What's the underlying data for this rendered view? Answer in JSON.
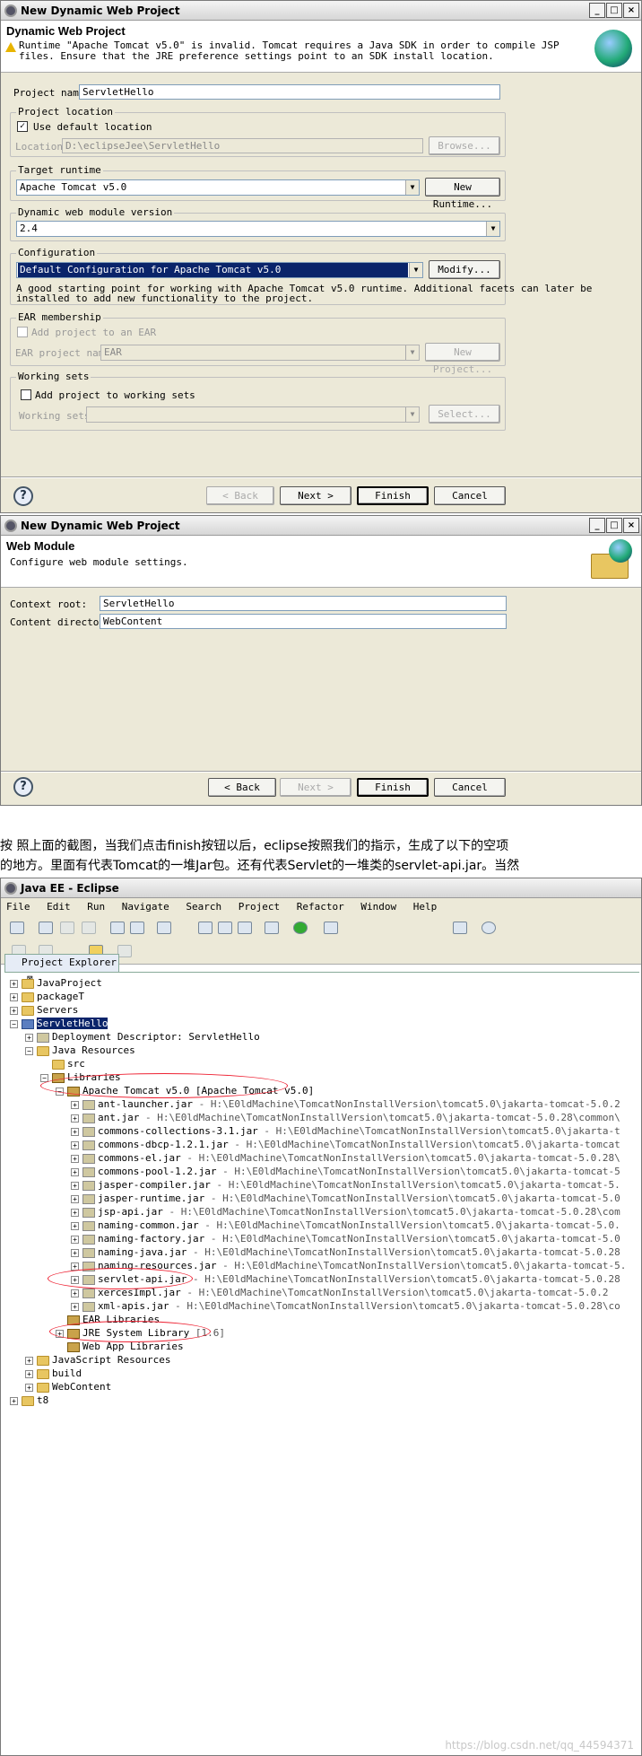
{
  "dialog1": {
    "title": "New Dynamic Web Project",
    "heading": "Dynamic Web Project",
    "warning_line1": "Runtime \"Apache Tomcat v5.0\" is invalid. Tomcat requires a Java SDK in order to compile JSP",
    "warning_line2": "files. Ensure that the JRE preference settings point to an SDK install location.",
    "project_name_label": "Project name:",
    "project_name_value": "ServletHello",
    "location_group": "Project location",
    "use_default_label": "Use default location",
    "location_label": "Location:",
    "location_value": "D:\\eclipseJee\\ServletHello",
    "browse_label": "Browse...",
    "target_runtime_group": "Target runtime",
    "target_runtime_value": "Apache Tomcat v5.0",
    "new_runtime_label": "New Runtime...",
    "module_version_group": "Dynamic web module version",
    "module_version_value": "2.4",
    "configuration_group": "Configuration",
    "configuration_value": "Default Configuration for Apache Tomcat v5.0",
    "modify_label": "Modify...",
    "configuration_desc1": "A good starting point for working with Apache Tomcat v5.0 runtime. Additional facets can later be",
    "configuration_desc2": "installed to add new functionality to the project.",
    "ear_group": "EAR membership",
    "add_to_ear_label": "Add project to an EAR",
    "ear_name_label": "EAR project name:",
    "ear_name_value": "EAR",
    "new_project_label": "New Project...",
    "working_sets_group": "Working sets",
    "add_working_sets_label": "Add project to working sets",
    "working_sets_label": "Working sets:",
    "select_label": "Select...",
    "back_label": "< Back",
    "next_label": "Next >",
    "finish_label": "Finish",
    "cancel_label": "Cancel"
  },
  "dialog2": {
    "title": "New Dynamic Web Project",
    "heading": "Web Module",
    "subheading": "Configure web module settings.",
    "context_root_label": "Context root:",
    "context_root_value": "ServletHello",
    "content_dir_label": "Content directory:",
    "content_dir_value": "WebContent",
    "back_label": "< Back",
    "next_label": "Next >",
    "finish_label": "Finish",
    "cancel_label": "Cancel"
  },
  "note": {
    "line1": "按 照上面的截图，当我们点击finish按钮以后，eclipse按照我们的指示，生成了以下的空项",
    "line2": "的地方。里面有代表Tomcat的一堆Jar包。还有代表Servlet的一堆类的servlet-api.jar。当然"
  },
  "eclipse": {
    "title": "Java EE - Eclipse",
    "menu": [
      "File",
      "Edit",
      "Run",
      "Navigate",
      "Search",
      "Project",
      "Refactor",
      "Window",
      "Help"
    ],
    "view_tab": "Project Explorer",
    "tree": [
      {
        "indent": 0,
        "pm": "+",
        "icon": "folder",
        "label": "JavaProject",
        "path": ""
      },
      {
        "indent": 0,
        "pm": "+",
        "icon": "folder",
        "label": "packageT",
        "path": ""
      },
      {
        "indent": 0,
        "pm": "+",
        "icon": "folder",
        "label": "Servers",
        "path": ""
      },
      {
        "indent": 0,
        "pm": "-",
        "icon": "proj",
        "label": "ServletHello",
        "path": "",
        "selected": true
      },
      {
        "indent": 1,
        "pm": "+",
        "icon": "jar",
        "label": "Deployment Descriptor: ServletHello",
        "path": ""
      },
      {
        "indent": 1,
        "pm": "-",
        "icon": "folder",
        "label": "Java Resources",
        "path": ""
      },
      {
        "indent": 2,
        "pm": "",
        "icon": "folder",
        "label": "src",
        "path": ""
      },
      {
        "indent": 2,
        "pm": "-",
        "icon": "lib",
        "label": "Libraries",
        "path": ""
      },
      {
        "indent": 3,
        "pm": "-",
        "icon": "lib",
        "label": "Apache Tomcat v5.0 [Apache Tomcat v5.0]",
        "path": ""
      },
      {
        "indent": 4,
        "pm": "+",
        "icon": "jar",
        "label": "ant-launcher.jar",
        "path": " - H:\\E0ldMachine\\TomcatNonInstallVersion\\tomcat5.0\\jakarta-tomcat-5.0.2"
      },
      {
        "indent": 4,
        "pm": "+",
        "icon": "jar",
        "label": "ant.jar",
        "path": " - H:\\E0ldMachine\\TomcatNonInstallVersion\\tomcat5.0\\jakarta-tomcat-5.0.28\\common\\"
      },
      {
        "indent": 4,
        "pm": "+",
        "icon": "jar",
        "label": "commons-collections-3.1.jar",
        "path": " - H:\\E0ldMachine\\TomcatNonInstallVersion\\tomcat5.0\\jakarta-t"
      },
      {
        "indent": 4,
        "pm": "+",
        "icon": "jar",
        "label": "commons-dbcp-1.2.1.jar",
        "path": " - H:\\E0ldMachine\\TomcatNonInstallVersion\\tomcat5.0\\jakarta-tomcat"
      },
      {
        "indent": 4,
        "pm": "+",
        "icon": "jar",
        "label": "commons-el.jar",
        "path": " - H:\\E0ldMachine\\TomcatNonInstallVersion\\tomcat5.0\\jakarta-tomcat-5.0.28\\"
      },
      {
        "indent": 4,
        "pm": "+",
        "icon": "jar",
        "label": "commons-pool-1.2.jar",
        "path": " - H:\\E0ldMachine\\TomcatNonInstallVersion\\tomcat5.0\\jakarta-tomcat-5"
      },
      {
        "indent": 4,
        "pm": "+",
        "icon": "jar",
        "label": "jasper-compiler.jar",
        "path": " - H:\\E0ldMachine\\TomcatNonInstallVersion\\tomcat5.0\\jakarta-tomcat-5."
      },
      {
        "indent": 4,
        "pm": "+",
        "icon": "jar",
        "label": "jasper-runtime.jar",
        "path": " - H:\\E0ldMachine\\TomcatNonInstallVersion\\tomcat5.0\\jakarta-tomcat-5.0"
      },
      {
        "indent": 4,
        "pm": "+",
        "icon": "jar",
        "label": "jsp-api.jar",
        "path": " - H:\\E0ldMachine\\TomcatNonInstallVersion\\tomcat5.0\\jakarta-tomcat-5.0.28\\com"
      },
      {
        "indent": 4,
        "pm": "+",
        "icon": "jar",
        "label": "naming-common.jar",
        "path": " - H:\\E0ldMachine\\TomcatNonInstallVersion\\tomcat5.0\\jakarta-tomcat-5.0."
      },
      {
        "indent": 4,
        "pm": "+",
        "icon": "jar",
        "label": "naming-factory.jar",
        "path": " - H:\\E0ldMachine\\TomcatNonInstallVersion\\tomcat5.0\\jakarta-tomcat-5.0"
      },
      {
        "indent": 4,
        "pm": "+",
        "icon": "jar",
        "label": "naming-java.jar",
        "path": " - H:\\E0ldMachine\\TomcatNonInstallVersion\\tomcat5.0\\jakarta-tomcat-5.0.28"
      },
      {
        "indent": 4,
        "pm": "+",
        "icon": "jar",
        "label": "naming-resources.jar",
        "path": " - H:\\E0ldMachine\\TomcatNonInstallVersion\\tomcat5.0\\jakarta-tomcat-5."
      },
      {
        "indent": 4,
        "pm": "+",
        "icon": "jar",
        "label": "servlet-api.jar",
        "path": " - H:\\E0ldMachine\\TomcatNonInstallVersion\\tomcat5.0\\jakarta-tomcat-5.0.28"
      },
      {
        "indent": 4,
        "pm": "+",
        "icon": "jar",
        "label": "xercesImpl.jar",
        "path": " - H:\\E0ldMachine\\TomcatNonInstallVersion\\tomcat5.0\\jakarta-tomcat-5.0.2"
      },
      {
        "indent": 4,
        "pm": "+",
        "icon": "jar",
        "label": "xml-apis.jar",
        "path": " - H:\\E0ldMachine\\TomcatNonInstallVersion\\tomcat5.0\\jakarta-tomcat-5.0.28\\co"
      },
      {
        "indent": 3,
        "pm": "",
        "icon": "lib",
        "label": "EAR Libraries",
        "path": ""
      },
      {
        "indent": 3,
        "pm": "+",
        "icon": "lib",
        "label": "JRE System Library",
        "path": " [1.6]"
      },
      {
        "indent": 3,
        "pm": "",
        "icon": "lib",
        "label": "Web App Libraries",
        "path": ""
      },
      {
        "indent": 1,
        "pm": "+",
        "icon": "folder",
        "label": "JavaScript Resources",
        "path": ""
      },
      {
        "indent": 1,
        "pm": "+",
        "icon": "folder",
        "label": "build",
        "path": ""
      },
      {
        "indent": 1,
        "pm": "+",
        "icon": "folder",
        "label": "WebContent",
        "path": ""
      },
      {
        "indent": 0,
        "pm": "+",
        "icon": "folder",
        "label": "t8",
        "path": ""
      }
    ]
  },
  "watermark": "https://blog.csdn.net/qq_44594371"
}
